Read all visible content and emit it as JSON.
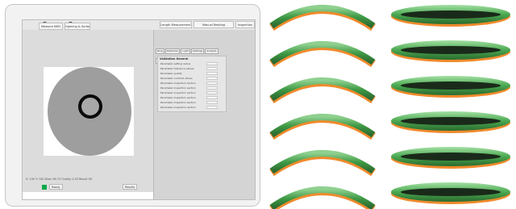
{
  "screenshot": {
    "toolbar": {
      "buttons": [
        "Measure MSD",
        "Opening & Surface"
      ],
      "right_buttons": [
        "Length Measurement",
        "Manual Reading"
      ],
      "right_extra": "Inspection"
    },
    "right_panel": {
      "tabs": [
        "Ring",
        "Detection",
        "Light",
        "Settings",
        "Analysis"
      ],
      "subtabs": [
        "Edges",
        "Points",
        "Defects"
      ],
      "list_title": "Validation General",
      "items": [
        "Parameter setting radius",
        "Parameter tolerance values",
        "Parameter quality",
        "Parameter contrast values",
        "Parameter inspection section",
        "Parameter inspection section",
        "Parameter inspection section",
        "Parameter inspection section",
        "Parameter inspection section",
        "Parameter inspection section"
      ]
    },
    "status": {
      "row_text": "X: 100   Y: 100   Diam 89.75   Ovality 0.03   Result OK",
      "bottom_button": "Results",
      "bottom_label": "Ready"
    }
  },
  "photos": {
    "left_column": 6,
    "right_column": 6,
    "colors": {
      "green": "#4caf50",
      "orange": "#f08a2c",
      "dark": "#1a2a1a"
    }
  }
}
